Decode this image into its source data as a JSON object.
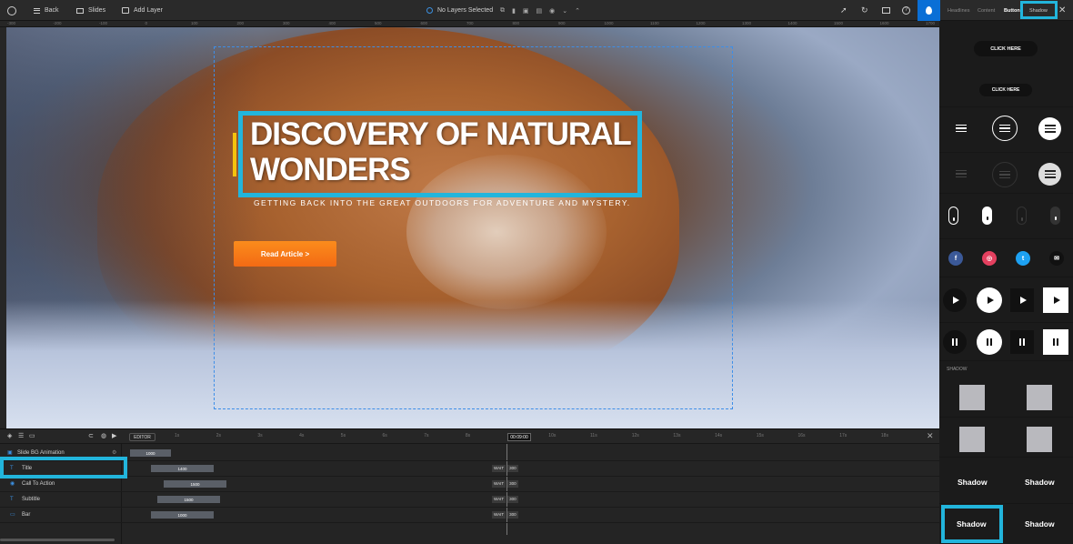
{
  "toolbar": {
    "back_label": "Back",
    "slides_label": "Slides",
    "add_layer_label": "Add Layer",
    "selection_status": "No Layers Selected"
  },
  "right_tabs": [
    "Headlines",
    "Content",
    "Buttons",
    "Shadow"
  ],
  "ruler_marks": [
    "-300",
    "-200",
    "-100",
    "0",
    "100",
    "200",
    "300",
    "400",
    "500",
    "600",
    "700",
    "800",
    "900",
    "1000",
    "1100",
    "1200",
    "1300",
    "1400",
    "1500",
    "1600",
    "1700"
  ],
  "slide": {
    "headline_line1": "DISCOVERY OF NATURAL",
    "headline_line2": "WONDERS",
    "subtitle": "GETTING BACK INTO THE GREAT OUTDOORS FOR ADVENTURE AND MYSTERY.",
    "cta_label": "Read Article >"
  },
  "panel": {
    "pill_large": "CLICK HERE",
    "pill_small": "CLICK HERE",
    "social_labels": [
      "f",
      "◎",
      "t",
      "✉"
    ],
    "shadow_section_label": "SHADOW",
    "shadow_text": [
      "Shadow",
      "Shadow",
      "Shadow",
      "Shadow"
    ]
  },
  "timeline": {
    "editor_label": "EDITOR",
    "current_time": "00:09:00",
    "ticks": [
      "1s",
      "2s",
      "3s",
      "4s",
      "5s",
      "6s",
      "7s",
      "8s",
      "9s",
      "10s",
      "11s",
      "12s",
      "13s",
      "14s",
      "15s",
      "16s",
      "17s",
      "18s"
    ],
    "rows": [
      {
        "label": "Slide BG Animation",
        "bar": "1000",
        "wait": "",
        "wait_val": ""
      },
      {
        "label": "Title",
        "bar": "1400",
        "wait": "WAIT",
        "wait_val": "300"
      },
      {
        "label": "Call To Action",
        "bar": "1500",
        "wait": "WAIT",
        "wait_val": "300"
      },
      {
        "label": "Subtitle",
        "bar": "1500",
        "wait": "WAIT",
        "wait_val": "300"
      },
      {
        "label": "Bar",
        "bar": "1000",
        "wait": "WAIT",
        "wait_val": "300"
      }
    ]
  },
  "colors": {
    "highlight": "#22b5dc",
    "accent_blue": "#0a6fd6",
    "cta_orange": "#f36a14",
    "accent_yellow": "#f4c20d"
  }
}
